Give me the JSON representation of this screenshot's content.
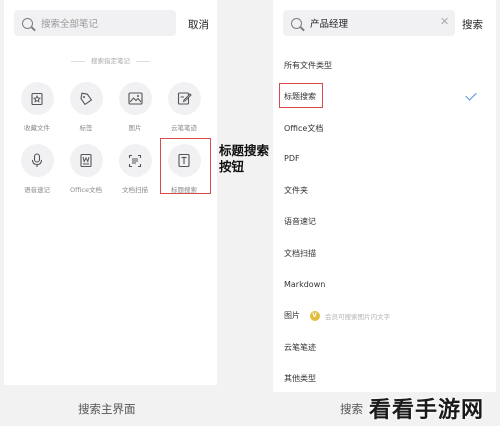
{
  "left": {
    "search_placeholder": "搜索全部笔记",
    "cancel_label": "取消",
    "section_label": "搜索指定笔记",
    "types": [
      {
        "label": "收藏文件",
        "icon": "star-file-icon"
      },
      {
        "label": "标签",
        "icon": "tag-icon"
      },
      {
        "label": "图片",
        "icon": "image-icon"
      },
      {
        "label": "云笔笔迹",
        "icon": "pen-note-icon"
      },
      {
        "label": "语音速记",
        "icon": "microphone-icon"
      },
      {
        "label": "Office文档",
        "icon": "word-doc-icon"
      },
      {
        "label": "文档扫描",
        "icon": "scan-icon"
      },
      {
        "label": "标题搜索",
        "icon": "title-t-icon"
      }
    ],
    "callout": "标题搜索按钮"
  },
  "right": {
    "search_value": "产品经理",
    "search_label": "搜索",
    "items": [
      "所有文件类型",
      "标题搜索",
      "Office文档",
      "PDF",
      "文件夹",
      "语音速记",
      "文档扫描",
      "Markdown",
      "图片",
      "云笔笔迹",
      "其他类型"
    ],
    "vip_badge": "V",
    "vip_hint": "会员可搜索图片内文字"
  },
  "captions": {
    "left": "搜索主界面",
    "right": "搜索"
  },
  "watermark": "看看手游网",
  "colors": {
    "highlight": "#d94a4a",
    "check": "#4a90e2",
    "vip": "#e2bd3c"
  }
}
